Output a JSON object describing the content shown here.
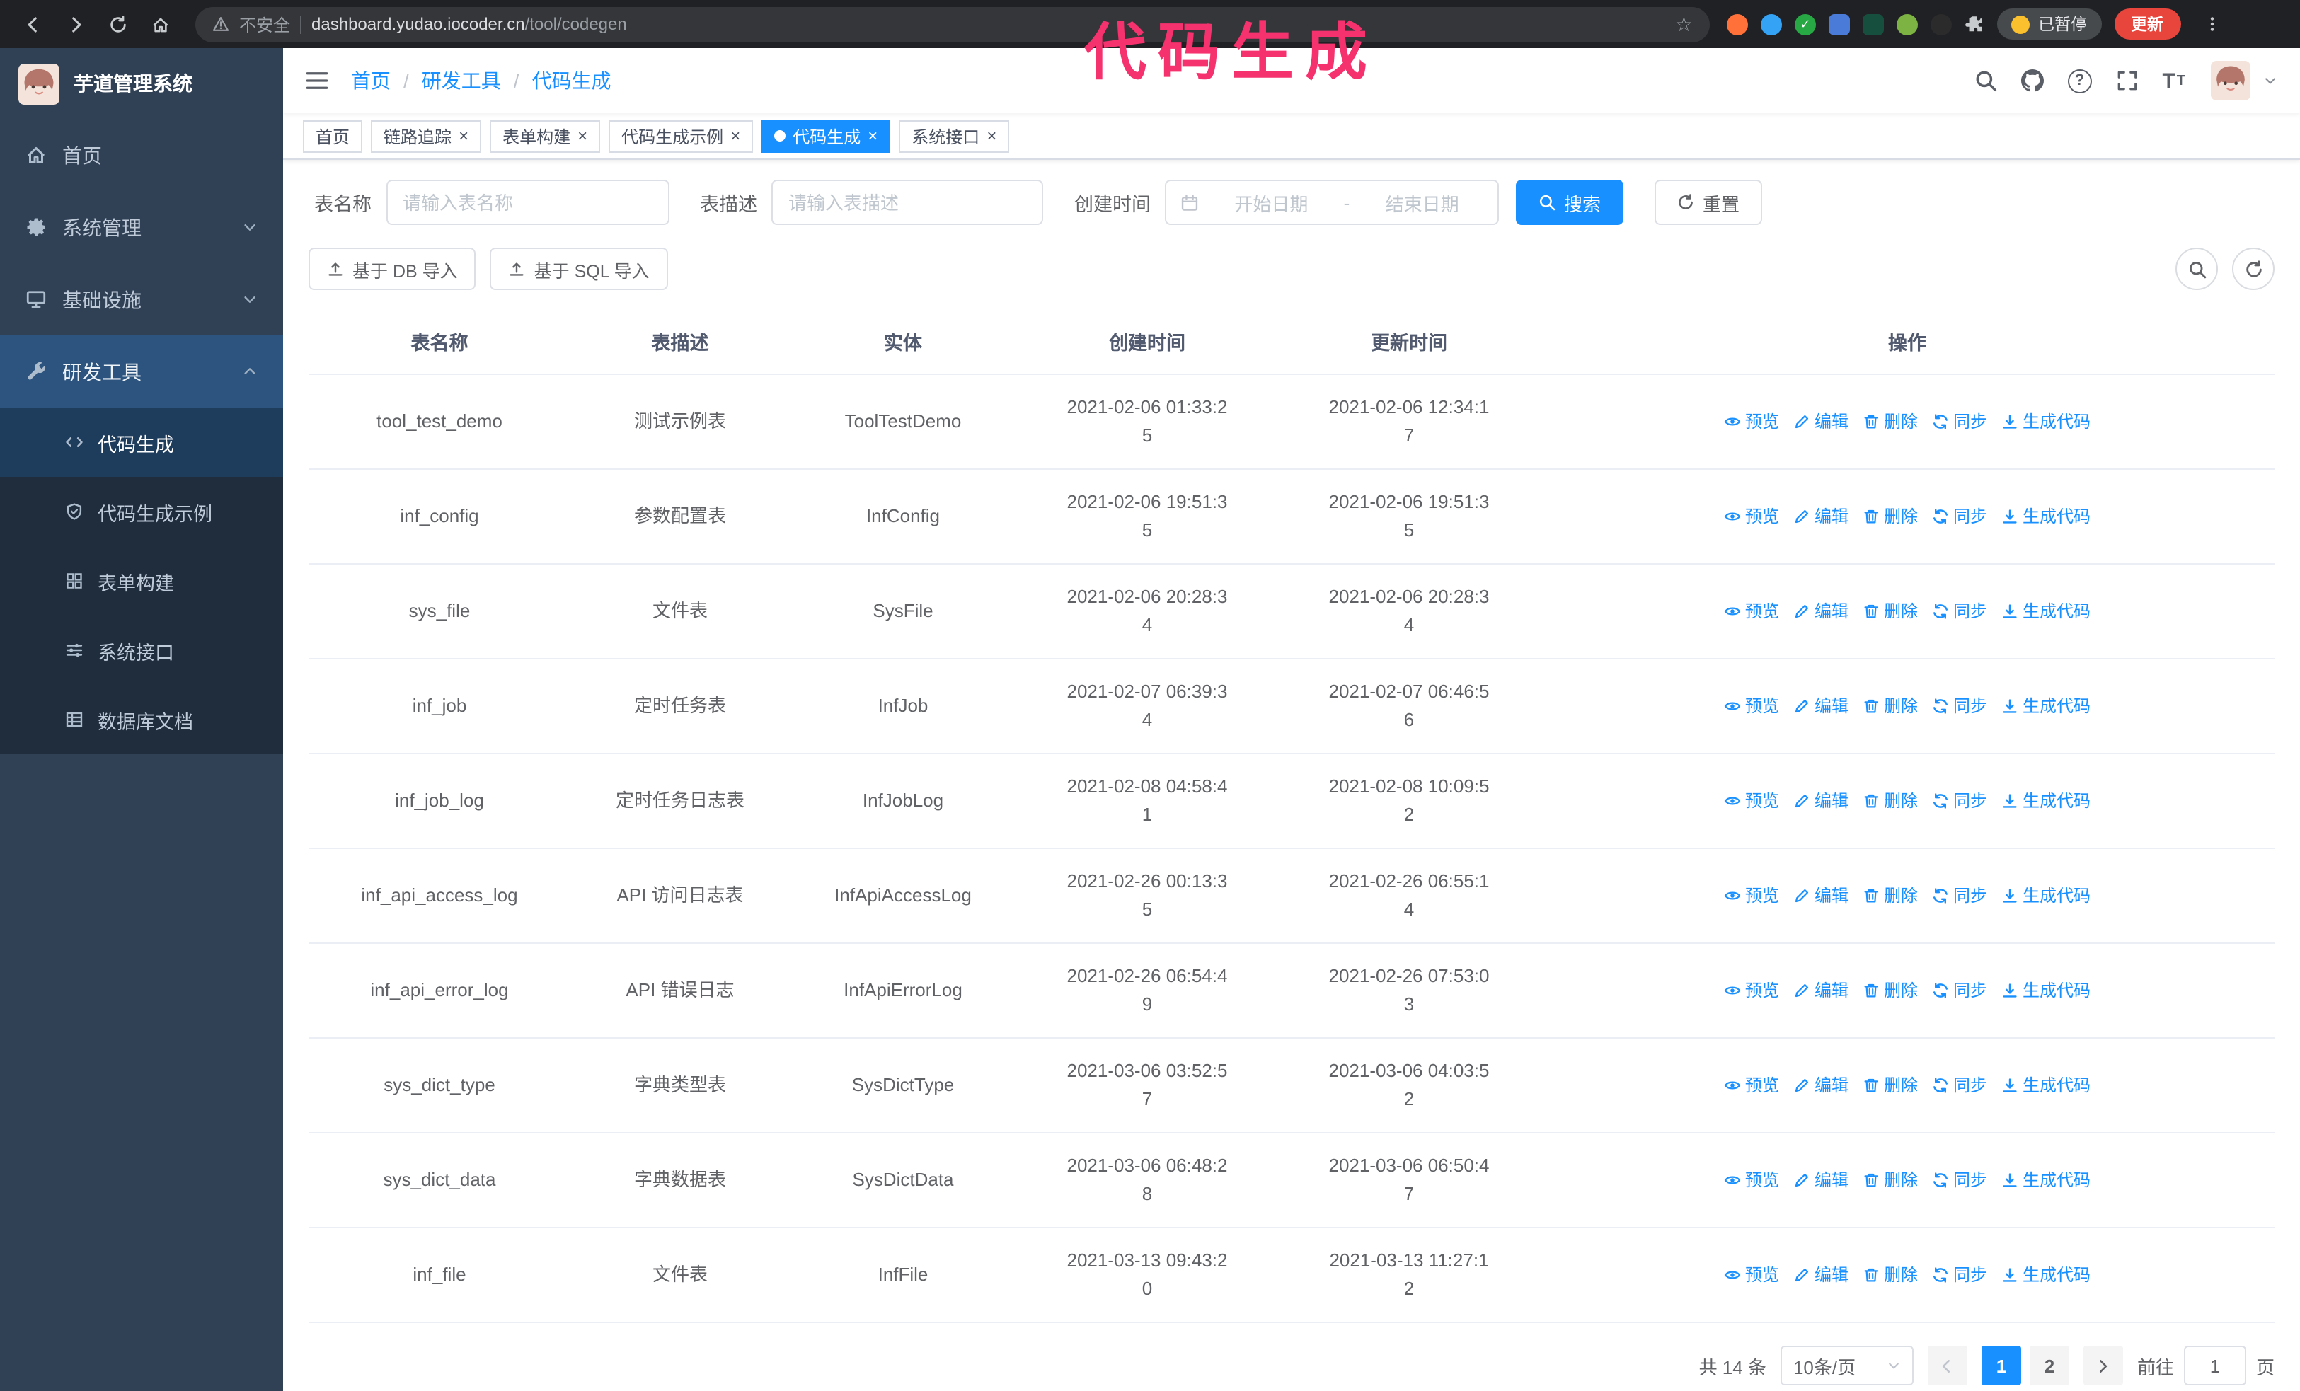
{
  "colors": {
    "accent": "#1890ff",
    "sidebar_bg": "#304156",
    "annotation": "#f6326e"
  },
  "annotation": {
    "text": "代码生成",
    "color": "#f6326e"
  },
  "browser": {
    "security_label": "不安全",
    "url_host": "dashboard.yudao.iocoder.cn",
    "url_path": "/tool/codegen",
    "paused_badge": "已暂停",
    "update_button": "更新"
  },
  "sidebar": {
    "app_title": "芋道管理系统",
    "items": [
      {
        "label": "首页",
        "icon": "home"
      },
      {
        "label": "系统管理",
        "icon": "gear",
        "chevron": "down"
      },
      {
        "label": "基础设施",
        "icon": "monitor",
        "chevron": "down"
      },
      {
        "label": "研发工具",
        "icon": "wrench",
        "chevron": "up",
        "open": true
      }
    ],
    "subitems": [
      {
        "label": "代码生成",
        "icon": "code",
        "active": true
      },
      {
        "label": "代码生成示例",
        "icon": "shield"
      },
      {
        "label": "表单构建",
        "icon": "grid"
      },
      {
        "label": "系统接口",
        "icon": "sliders"
      },
      {
        "label": "数据库文档",
        "icon": "table"
      }
    ]
  },
  "header": {
    "breadcrumb": [
      "首页",
      "研发工具",
      "代码生成"
    ]
  },
  "tags": [
    {
      "label": "首页",
      "closable": false,
      "active": false
    },
    {
      "label": "链路追踪",
      "closable": true,
      "active": false
    },
    {
      "label": "表单构建",
      "closable": true,
      "active": false
    },
    {
      "label": "代码生成示例",
      "closable": true,
      "active": false
    },
    {
      "label": "代码生成",
      "closable": true,
      "active": true
    },
    {
      "label": "系统接口",
      "closable": true,
      "active": false
    }
  ],
  "filters": {
    "table_name_label": "表名称",
    "table_name_placeholder": "请输入表名称",
    "table_desc_label": "表描述",
    "table_desc_placeholder": "请输入表描述",
    "create_time_label": "创建时间",
    "date_start_placeholder": "开始日期",
    "date_separator": "-",
    "date_end_placeholder": "结束日期",
    "search_button": "搜索",
    "reset_button": "重置"
  },
  "toolbar": {
    "import_db": "基于 DB 导入",
    "import_sql": "基于 SQL 导入"
  },
  "table": {
    "columns": [
      "表名称",
      "表描述",
      "实体",
      "创建时间",
      "更新时间",
      "操作"
    ],
    "actions": [
      "预览",
      "编辑",
      "删除",
      "同步",
      "生成代码"
    ],
    "rows": [
      {
        "name": "tool_test_demo",
        "desc": "测试示例表",
        "entity": "ToolTestDemo",
        "created": "2021-02-06 01:33:25",
        "updated": "2021-02-06 12:34:17"
      },
      {
        "name": "inf_config",
        "desc": "参数配置表",
        "entity": "InfConfig",
        "created": "2021-02-06 19:51:35",
        "updated": "2021-02-06 19:51:35"
      },
      {
        "name": "sys_file",
        "desc": "文件表",
        "entity": "SysFile",
        "created": "2021-02-06 20:28:34",
        "updated": "2021-02-06 20:28:34"
      },
      {
        "name": "inf_job",
        "desc": "定时任务表",
        "entity": "InfJob",
        "created": "2021-02-07 06:39:34",
        "updated": "2021-02-07 06:46:56"
      },
      {
        "name": "inf_job_log",
        "desc": "定时任务日志表",
        "entity": "InfJobLog",
        "created": "2021-02-08 04:58:41",
        "updated": "2021-02-08 10:09:52"
      },
      {
        "name": "inf_api_access_log",
        "desc": "API 访问日志表",
        "entity": "InfApiAccessLog",
        "created": "2021-02-26 00:13:35",
        "updated": "2021-02-26 06:55:14"
      },
      {
        "name": "inf_api_error_log",
        "desc": "API 错误日志",
        "entity": "InfApiErrorLog",
        "created": "2021-02-26 06:54:49",
        "updated": "2021-02-26 07:53:03"
      },
      {
        "name": "sys_dict_type",
        "desc": "字典类型表",
        "entity": "SysDictType",
        "created": "2021-03-06 03:52:57",
        "updated": "2021-03-06 04:03:52"
      },
      {
        "name": "sys_dict_data",
        "desc": "字典数据表",
        "entity": "SysDictData",
        "created": "2021-03-06 06:48:28",
        "updated": "2021-03-06 06:50:47"
      },
      {
        "name": "inf_file",
        "desc": "文件表",
        "entity": "InfFile",
        "created": "2021-03-13 09:43:20",
        "updated": "2021-03-13 11:27:12"
      }
    ]
  },
  "pagination": {
    "total": "共 14 条",
    "page_size": "10条/页",
    "pages": [
      "1",
      "2"
    ],
    "active_page": "1",
    "goto_label": "前往",
    "goto_value": "1",
    "goto_unit": "页"
  }
}
